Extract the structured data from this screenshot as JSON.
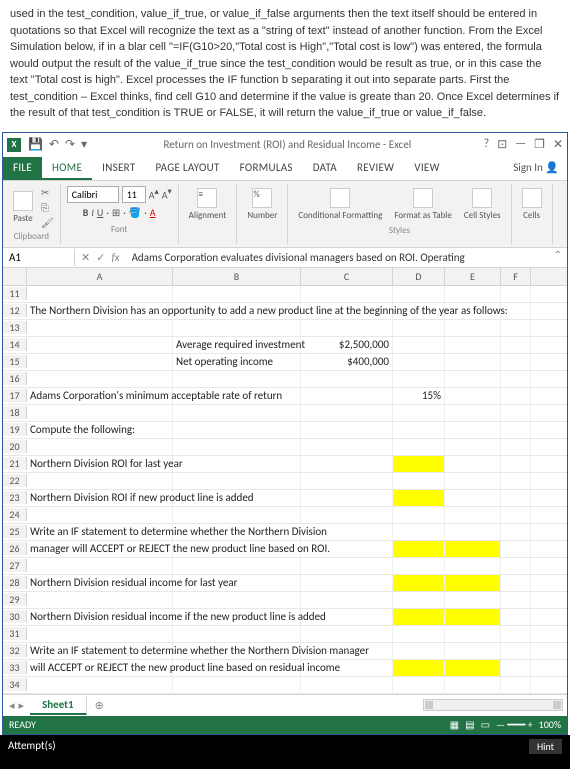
{
  "instruction": "used in the test_condition, value_if_true, or value_if_false arguments then the text itself should be entered in quotations so that Excel will recognize the text as a \"string of text\" instead of another function.  From the Excel Simulation below, if in a blar cell \"=IF(G10>20,\"Total cost is High\",\"Total cost is low\") was entered, the formula would output the result of the value_if_true since the test_condition would be result as true, or in this case the text \"Total cost is high\".  Excel processes the IF function b separating it out into separate parts.  First the test_condition – Excel thinks, find cell G10 and determine if the value is greate than 20.  Once Excel determines if the result of that test_condition is TRUE or FALSE, it will return the value_if_true or value_if_false.",
  "window": {
    "title": "Return on Investment (ROI) and Residual Income - Excel"
  },
  "ribbon": {
    "tabs": [
      "FILE",
      "HOME",
      "INSERT",
      "PAGE LAYOUT",
      "FORMULAS",
      "DATA",
      "REVIEW",
      "VIEW"
    ],
    "signin": "Sign In",
    "font": {
      "name": "Calibri",
      "size": "11"
    },
    "groups": {
      "clipboard": "Clipboard",
      "font": "Font",
      "alignment": "Alignment",
      "number": "Number",
      "condfmt": "Conditional Formatting",
      "fmttable": "Format as Table",
      "cellstyles": "Cell Styles",
      "cells": "Cells",
      "styles": "Styles",
      "paste": "Paste"
    }
  },
  "namebox": "A1",
  "formula": "Adams Corporation evaluates divisional managers based on ROI. Operating",
  "cols": [
    "A",
    "B",
    "C",
    "D",
    "E",
    "F"
  ],
  "rows": {
    "r12": "The Northern Division has an opportunity to add a new product line at the beginning of the year as follows:",
    "r14b": "Average required investment",
    "r14c_s": "$",
    "r14c": "2,500,000",
    "r15b": "Net operating income",
    "r15c_s": "$",
    "r15c": "400,000",
    "r17": "Adams Corporation's minimum acceptable rate of return",
    "r17d": "15%",
    "r19": "Compute the following:",
    "r21": "Northern Division ROI for last year",
    "r23": "Northern Division ROI if new product line is added",
    "r25": "Write an IF statement to determine whether the Northern Division",
    "r26": "manager will ACCEPT or REJECT the new product line based on ROI.",
    "r28": "Northern Division residual income for last year",
    "r30": "Northern Division residual income if the new product line is added",
    "r32": "Write an IF statement to determine whether the Northern Division manager",
    "r33": "will ACCEPT or REJECT the new product line based on residual income"
  },
  "sheet": {
    "tab": "Sheet1"
  },
  "status": {
    "ready": "READY",
    "zoom": "100%"
  },
  "footer": {
    "attempts": "Attempt(s)",
    "hint": "Hint"
  }
}
